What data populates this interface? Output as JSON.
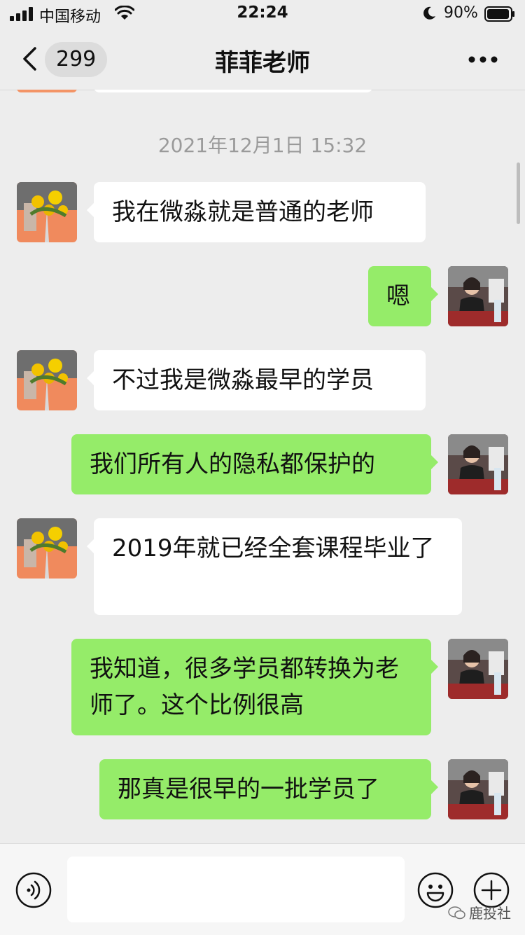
{
  "status_bar": {
    "carrier": "中国移动",
    "time": "22:24",
    "battery_percent": "90%",
    "icons": [
      "signal-icon",
      "wifi-icon",
      "moon-icon",
      "battery-icon"
    ]
  },
  "header": {
    "unread_count": "299",
    "title": "菲菲老师",
    "icons": [
      "back-icon",
      "more-icon"
    ]
  },
  "chat": {
    "timestamp": "2021年12月1日 15:32",
    "messages": [
      {
        "side": "left",
        "text": "我在微淼就是普通的老师"
      },
      {
        "side": "right",
        "text": "嗯"
      },
      {
        "side": "left",
        "text": "不过我是微淼最早的学员"
      },
      {
        "side": "right",
        "text": "我们所有人的隐私都保护的"
      },
      {
        "side": "left",
        "text": "2019年就已经全套课程毕业了"
      },
      {
        "side": "right",
        "text": "我知道，很多学员都转换为老师了。这个比例很高"
      },
      {
        "side": "right",
        "text": "那真是很早的一批学员了"
      }
    ]
  },
  "input_bar": {
    "icons": [
      "voice-icon",
      "emoji-icon",
      "plus-icon"
    ]
  },
  "watermark": {
    "text": "鹿投社"
  },
  "colors": {
    "background": "#ededed",
    "bubble_self": "#95ec69",
    "bubble_other": "#ffffff",
    "timestamp": "#9a9a9a"
  }
}
